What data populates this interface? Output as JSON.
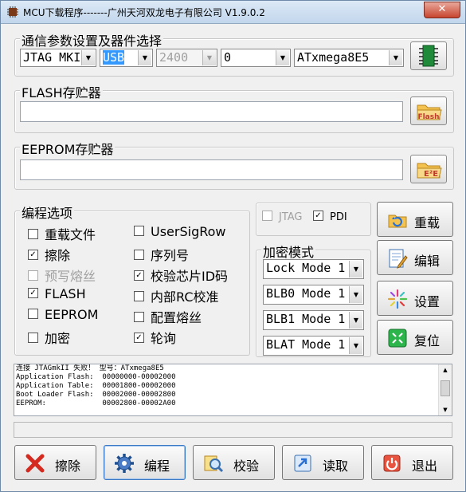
{
  "window": {
    "title": "MCU下载程序-------广州天河双龙电子有限公司 V1.9.0.2",
    "close": "✕"
  },
  "comm": {
    "group_label": "通信参数设置及器件选择",
    "programmer": "JTAG MKII",
    "port": "USB",
    "baud": "2400",
    "option": "0",
    "device": "ATxmega8E5"
  },
  "flash": {
    "group_label": "FLASH存贮器",
    "path": "",
    "button_label": "Flash"
  },
  "eeprom": {
    "group_label": "EEPROM存贮器",
    "path": ""
  },
  "options": {
    "group_label": "编程选项",
    "left": [
      {
        "label": "重载文件",
        "checked": false,
        "disabled": false
      },
      {
        "label": "擦除",
        "checked": true,
        "disabled": false
      },
      {
        "label": "预写熔丝",
        "checked": false,
        "disabled": true
      },
      {
        "label": "FLASH",
        "checked": true,
        "disabled": false
      },
      {
        "label": "EEPROM",
        "checked": false,
        "disabled": false
      },
      {
        "label": "加密",
        "checked": false,
        "disabled": false
      }
    ],
    "right": [
      {
        "label": "UserSigRow",
        "checked": false,
        "disabled": false
      },
      {
        "label": "序列号",
        "checked": false,
        "disabled": false
      },
      {
        "label": "校验芯片ID码",
        "checked": true,
        "disabled": false
      },
      {
        "label": "内部RC校准",
        "checked": false,
        "disabled": false
      },
      {
        "label": "配置熔丝",
        "checked": false,
        "disabled": false
      },
      {
        "label": "轮询",
        "checked": true,
        "disabled": false
      }
    ]
  },
  "interface": {
    "jtag": {
      "label": "JTAG",
      "checked": false,
      "disabled": true
    },
    "pdi": {
      "label": "PDI",
      "checked": true,
      "disabled": false
    }
  },
  "encryption": {
    "group_label": "加密模式",
    "modes": [
      "Lock Mode 1",
      "BLB0 Mode 1",
      "BLB1 Mode 1",
      "BLAT Mode 1"
    ]
  },
  "side_buttons": {
    "reload": "重载",
    "edit": "编辑",
    "settings": "设置",
    "reset": "复位"
  },
  "log": [
    "连接 JTAGmkII 失败！ 型号：ATxmega8E5",
    "Application Flash:  00000000-00002000",
    "Application Table:  00001800-00002000",
    "Boot Loader Flash:  00002000-00002800",
    "EEPROM:             00002800-00002A00"
  ],
  "bottom_buttons": {
    "erase": "擦除",
    "program": "编程",
    "verify": "校验",
    "read": "读取",
    "exit": "退出"
  },
  "colors": {
    "accent": "#3399ff",
    "close": "#c7452f"
  }
}
